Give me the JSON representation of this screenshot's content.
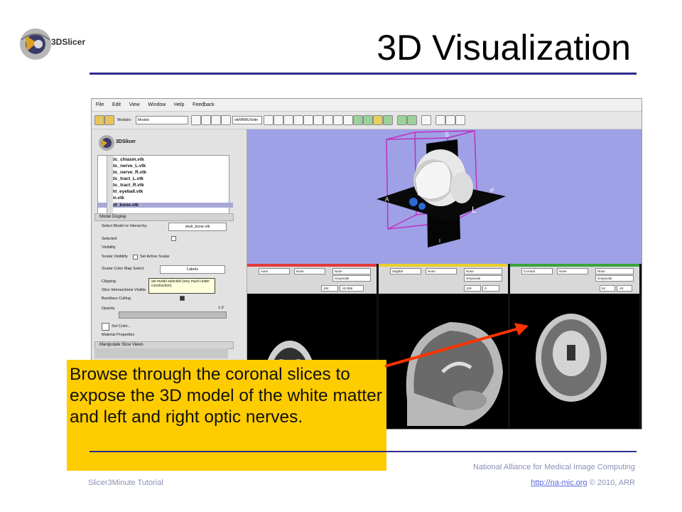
{
  "slide": {
    "title": "3D Visualization",
    "logo_text": "3DSlicer",
    "callout_text": "Browse through the coronal slices to expose the 3D model of the white matter and left and right optic nerves.",
    "footer": {
      "org": "National Alliance for Medical Image Computing",
      "tutorial": "Slicer3Minute Tutorial",
      "link": "http://na-mic.org",
      "copyright": "© 2010, ARR"
    },
    "colors": {
      "title_rule": "#2c2c8c",
      "callout_bg": "#ffcc00",
      "arrow": "#ff3300",
      "footer_text": "#8a8fb5"
    }
  },
  "app": {
    "menu": [
      "File",
      "Edit",
      "View",
      "Window",
      "Help",
      "Feedback"
    ],
    "toolbar": {
      "module_label": "Modules:",
      "module_value": "Models",
      "search_value": "vtkMRMLNode"
    },
    "logo_text": "3DSlicer",
    "model_tree": [
      "optic_chiasm.vtk",
      "optic_nerve_L.vtk",
      "optic_nerve_R.vtk",
      "optic_tract_L.vtk",
      "optic_tract_R.vtk",
      "right_eyeball.vtk",
      "Skin.vtk",
      "skull_bone.vtk"
    ],
    "model_display": {
      "header": "Model Display",
      "select_label": "Select Model or Hierarchy:",
      "select_value": "skull_bone.vtk",
      "selected_label": "Selected",
      "visibility_label": "Visibility",
      "scalar_visibility_label": "Scalar Visibility",
      "set_active_label": "Set Active Scalar",
      "scalar_colormap_label": "Scalar Color Map Select",
      "scalar_colormap_value": "Labels",
      "clipping_label": "Clipping",
      "slice_intersections_label": "Slice Intersections Visible",
      "backface_label": "Backface Culling",
      "opacity_label": "Opacity",
      "opacity_value": "1.0",
      "set_color_label": "Set Color...",
      "material_label": "Material Properties",
      "tooltip": "set model selected (very much under construction)"
    },
    "manipulate_header": "Manipulate Slice Views",
    "view3d_labels": {
      "s": "S",
      "a": "A",
      "r": "R",
      "p": "P",
      "l": "L",
      "i": "I"
    },
    "slice_views": [
      {
        "name": "Axial",
        "bar": "#e23b3b",
        "fg": "None",
        "bg": "Grayscale",
        "offset": "104",
        "value": "-22.959"
      },
      {
        "name": "Sagittal",
        "bar": "#e8cf2a",
        "fg": "None",
        "bg": "Grayscale",
        "offset": "129",
        "value": "0"
      },
      {
        "name": "Coronal",
        "bar": "#3aa43a",
        "fg": "None",
        "bg": "Grayscale",
        "offset": "64",
        "value": "-24"
      }
    ]
  }
}
